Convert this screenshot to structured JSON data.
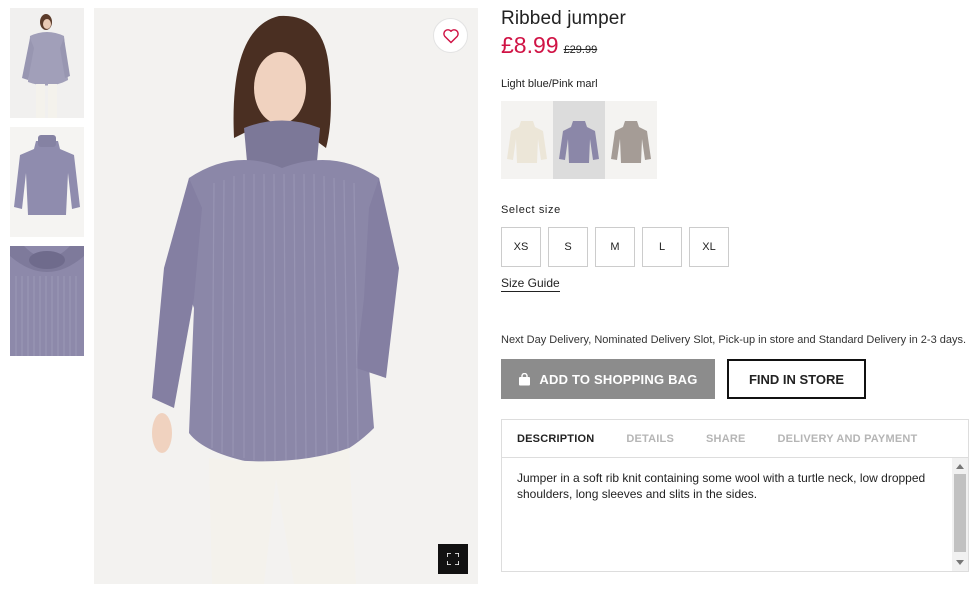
{
  "product": {
    "title": "Ribbed jumper",
    "price": "£8.99",
    "old_price": "£29.99",
    "color_label": "Light blue/Pink marl",
    "colors": [
      {
        "name": "cream",
        "hex": "#ece6d8"
      },
      {
        "name": "light-blue-pink-marl",
        "hex": "#8b87a8"
      },
      {
        "name": "grey-marl",
        "hex": "#a59c96"
      }
    ],
    "selected_color_index": 1
  },
  "sizes": {
    "title": "Select size",
    "options": [
      "XS",
      "S",
      "M",
      "L",
      "XL"
    ],
    "guide_label": "Size Guide"
  },
  "delivery_note": "Next Day Delivery, Nominated Delivery Slot, Pick-up in store and Standard Delivery in 2-3 days.",
  "actions": {
    "add_to_bag": "ADD TO SHOPPING BAG",
    "find_in_store": "FIND IN STORE"
  },
  "tabs": {
    "items": [
      "DESCRIPTION",
      "DETAILS",
      "SHARE",
      "DELIVERY AND PAYMENT"
    ],
    "active_index": 0,
    "description": "Jumper in a soft rib knit containing some wool with a turtle neck, low dropped shoulders, long sleeves and slits in the sides."
  },
  "colors": {
    "accent_price": "#d01345",
    "button_grey": "#8c8c8c",
    "sweater": "#8b87a8"
  },
  "icons": [
    "heart-icon",
    "fullscreen-icon",
    "shopping-bag-icon"
  ]
}
